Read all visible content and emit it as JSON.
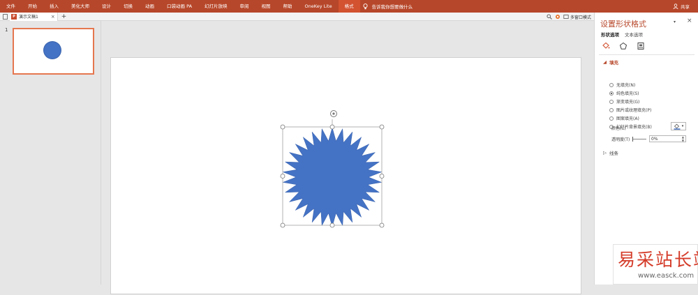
{
  "ribbon": {
    "tabs": [
      "文件",
      "开始",
      "插入",
      "美化大师",
      "设计",
      "切换",
      "动画",
      "口袋动画 PA",
      "幻灯片放映",
      "审阅",
      "视图",
      "帮助",
      "OneKey Lite",
      "格式"
    ],
    "active_tab": "格式",
    "tell_me": "告诉我你想要做什么",
    "share": "共享",
    "accent_color": "#b7472a"
  },
  "tabstrip": {
    "doc_tab_label": "演示文稿1",
    "close_glyph": "×",
    "new_tab_glyph": "+",
    "multi_window": "多窗口模式"
  },
  "thumbnails": {
    "slide_number": "1",
    "selected_border_color": "#e5774f"
  },
  "shape": {
    "type": "star-burst",
    "fill_color": "#4472c4",
    "rotate_icon": "rotate-handle-icon"
  },
  "pane": {
    "title": "设置形状格式",
    "dropdown_glyph": "▾",
    "close_glyph": "×",
    "tabs": {
      "shape": "形状选项",
      "text": "文本选项"
    },
    "icons": [
      "fill-bucket-icon",
      "pentagon-icon",
      "size-properties-icon"
    ],
    "fill_header": "填充",
    "fill_options": [
      {
        "label": "无填充(N)",
        "checked": false
      },
      {
        "label": "纯色填充(S)",
        "checked": true
      },
      {
        "label": "渐变填充(G)",
        "checked": false
      },
      {
        "label": "图片或纹理填充(P)",
        "checked": false
      },
      {
        "label": "图案填充(A)",
        "checked": false
      },
      {
        "label": "幻灯片背景填充(B)",
        "checked": false
      }
    ],
    "color_label": "颜色(C)",
    "transparency_label": "透明度(T)",
    "transparency_value": "0%",
    "line_header": "线条"
  },
  "watermark": {
    "chinese": "易采站长站",
    "english": "www.easck.com"
  }
}
